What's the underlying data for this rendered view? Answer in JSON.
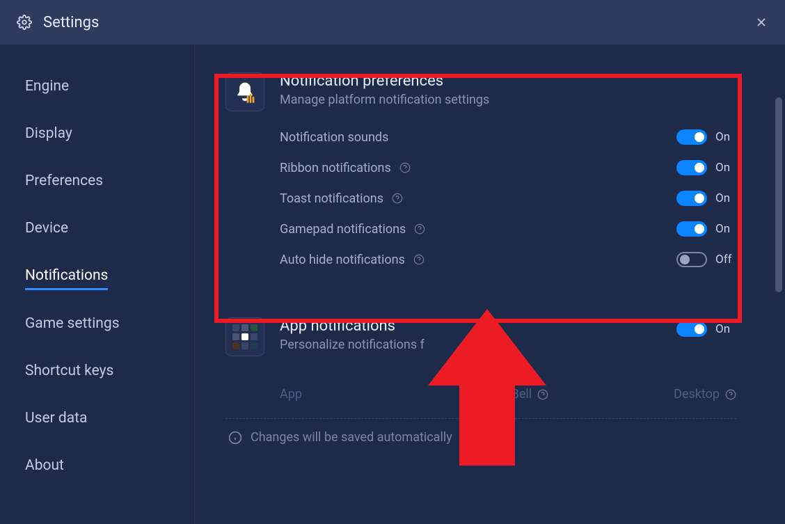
{
  "header": {
    "title": "Settings"
  },
  "sidebar": {
    "items": [
      {
        "label": "Engine"
      },
      {
        "label": "Display"
      },
      {
        "label": "Preferences"
      },
      {
        "label": "Device"
      },
      {
        "label": "Notifications",
        "active": true
      },
      {
        "label": "Game settings"
      },
      {
        "label": "Shortcut keys"
      },
      {
        "label": "User data"
      },
      {
        "label": "About"
      }
    ]
  },
  "section_prefs": {
    "title": "Notification preferences",
    "subtitle": "Manage platform notification settings",
    "rows": [
      {
        "label": "Notification sounds",
        "has_help": false,
        "state": "On",
        "on": true
      },
      {
        "label": "Ribbon notifications",
        "has_help": true,
        "state": "On",
        "on": true
      },
      {
        "label": "Toast notifications",
        "has_help": true,
        "state": "On",
        "on": true
      },
      {
        "label": "Gamepad notifications",
        "has_help": true,
        "state": "On",
        "on": true
      },
      {
        "label": "Auto hide notifications",
        "has_help": true,
        "state": "Off",
        "on": false
      }
    ]
  },
  "section_app": {
    "title": "App notifications",
    "subtitle": "Personalize notifications f",
    "toggle_state": "On",
    "columns": {
      "app": "App",
      "bell": "Bell",
      "desktop": "Desktop"
    }
  },
  "footer": {
    "save_note": "Changes will be saved automatically"
  }
}
